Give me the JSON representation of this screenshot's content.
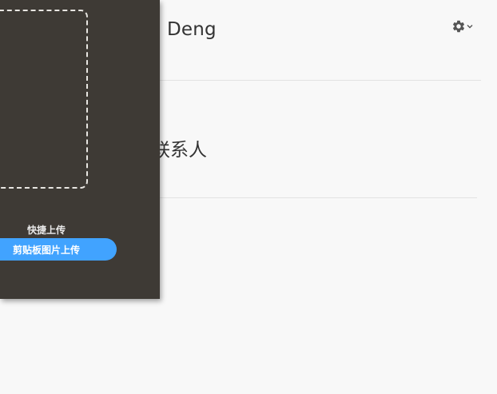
{
  "header": {
    "name": "Deng",
    "settings_icon": "gear-icon",
    "dropdown_icon": "chevron-down-icon"
  },
  "main": {
    "section_title": "联系人"
  },
  "upload_panel": {
    "quick_upload_label": "快捷上传",
    "clipboard_button_label": "剪贴板图片上传",
    "accent_color": "#41a3ff",
    "panel_color": "#3e3a35"
  }
}
